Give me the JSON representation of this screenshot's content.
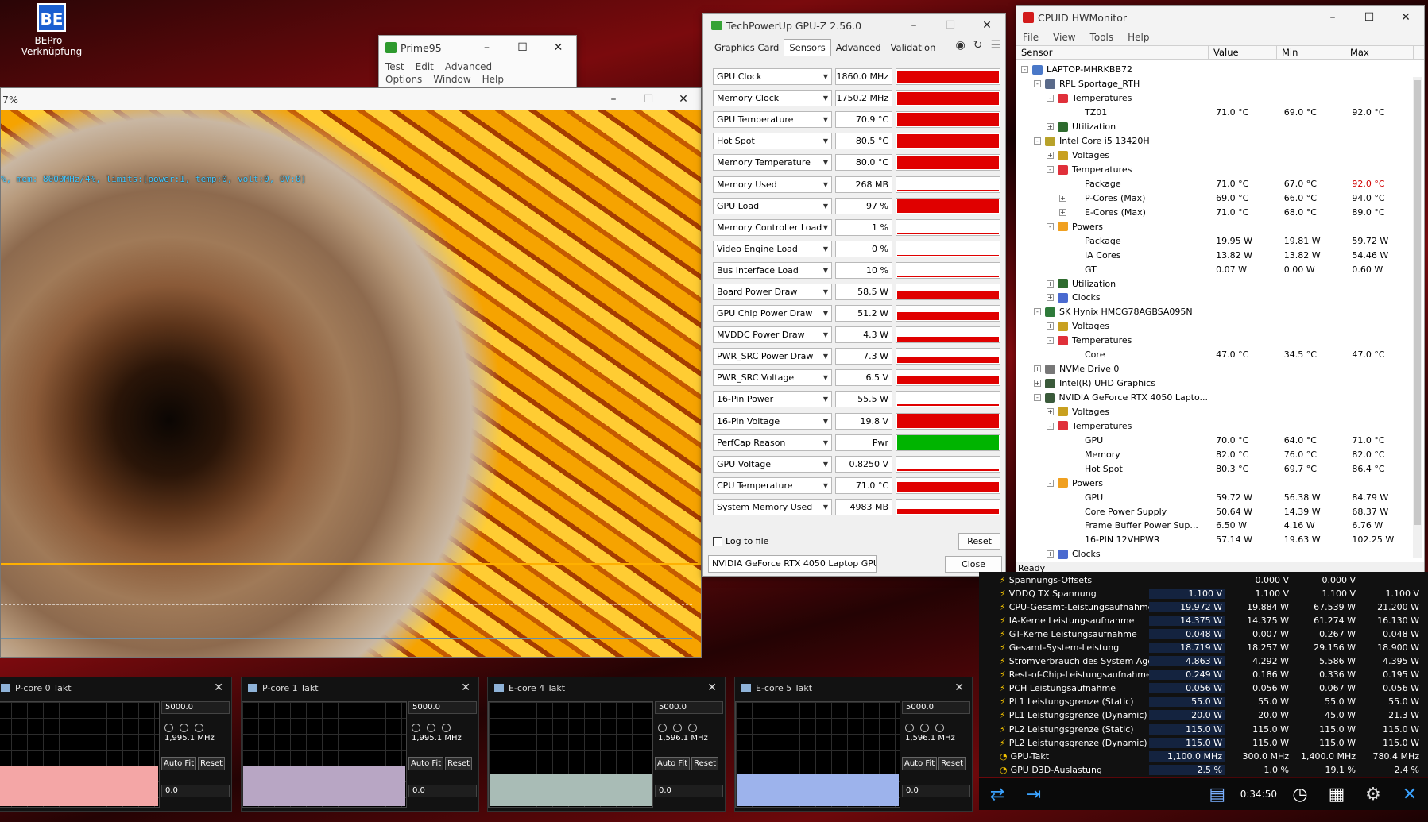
{
  "desktop": {
    "icon_label": "BEPro - Verknüpfung",
    "icon_text": "BE"
  },
  "prime95": {
    "title": "Prime95",
    "menu": [
      "Test",
      "Edit",
      "Advanced",
      "Options",
      "Window",
      "Help"
    ]
  },
  "bench": {
    "title_pct": "7%",
    "osd": "%, mem: 8000MHz/4%, limits:[power:1, temp:0, volt:0, OV:0]"
  },
  "gpuz": {
    "title": "TechPowerUp GPU-Z 2.56.0",
    "tabs": [
      "Graphics Card",
      "Sensors",
      "Advanced",
      "Validation"
    ],
    "active_tab": "Sensors",
    "sensors": [
      {
        "label": "GPU Clock",
        "value": "1860.0 MHz",
        "level": 0.85
      },
      {
        "label": "Memory Clock",
        "value": "1750.2 MHz",
        "level": 0.85
      },
      {
        "label": "GPU Temperature",
        "value": "70.9 °C",
        "level": 0.9
      },
      {
        "label": "Hot Spot",
        "value": "80.5 °C",
        "level": 0.92
      },
      {
        "label": "Memory Temperature",
        "value": "80.0 °C",
        "level": 0.92
      },
      {
        "label": "Memory Used",
        "value": "268 MB",
        "level": 0.1
      },
      {
        "label": "GPU Load",
        "value": "97 %",
        "level": 0.97
      },
      {
        "label": "Memory Controller Load",
        "value": "1 %",
        "level": 0.0
      },
      {
        "label": "Video Engine Load",
        "value": "0 %",
        "level": 0.0
      },
      {
        "label": "Bus Interface Load",
        "value": "10 %",
        "level": 0.1
      },
      {
        "label": "Board Power Draw",
        "value": "58.5 W",
        "level": 0.55
      },
      {
        "label": "GPU Chip Power Draw",
        "value": "51.2 W",
        "level": 0.5
      },
      {
        "label": "MVDDC Power Draw",
        "value": "4.3 W",
        "level": 0.3
      },
      {
        "label": "PWR_SRC Power Draw",
        "value": "7.3 W",
        "level": 0.4
      },
      {
        "label": "PWR_SRC Voltage",
        "value": "6.5 V",
        "level": 0.55
      },
      {
        "label": "16-Pin Power",
        "value": "55.5 W",
        "level": 0.1
      },
      {
        "label": "16-Pin Voltage",
        "value": "19.8 V",
        "level": 0.95
      },
      {
        "label": "PerfCap Reason",
        "value": "Pwr",
        "level": 1.0,
        "green": true
      },
      {
        "label": "GPU Voltage",
        "value": "0.8250 V",
        "level": 0.15
      },
      {
        "label": "CPU Temperature",
        "value": "71.0 °C",
        "level": 0.7
      },
      {
        "label": "System Memory Used",
        "value": "4983 MB",
        "level": 0.3
      }
    ],
    "log_to_file": "Log to file",
    "reset": "Reset",
    "gpu_select": "NVIDIA GeForce RTX 4050 Laptop GPU",
    "close": "Close"
  },
  "hwmonitor": {
    "title": "CPUID HWMonitor",
    "menu": [
      "File",
      "View",
      "Tools",
      "Help"
    ],
    "columns": [
      "Sensor",
      "Value",
      "Min",
      "Max"
    ],
    "rows": [
      {
        "d": 0,
        "e": "-",
        "i": "pc",
        "n": "LAPTOP-MHRKBB72",
        "v": "",
        "mn": "",
        "mx": ""
      },
      {
        "d": 1,
        "e": "-",
        "i": "board",
        "n": "RPL Sportage_RTH",
        "v": "",
        "mn": "",
        "mx": ""
      },
      {
        "d": 2,
        "e": "-",
        "i": "temp",
        "n": "Temperatures",
        "v": "",
        "mn": "",
        "mx": ""
      },
      {
        "d": 3,
        "e": "",
        "i": "",
        "n": "TZ01",
        "v": "71.0 °C",
        "mn": "69.0 °C",
        "mx": "92.0 °C"
      },
      {
        "d": 2,
        "e": "+",
        "i": "util",
        "n": "Utilization",
        "v": "",
        "mn": "",
        "mx": ""
      },
      {
        "d": 1,
        "e": "-",
        "i": "cpu",
        "n": "Intel Core i5 13420H",
        "v": "",
        "mn": "",
        "mx": ""
      },
      {
        "d": 2,
        "e": "+",
        "i": "volt",
        "n": "Voltages",
        "v": "",
        "mn": "",
        "mx": ""
      },
      {
        "d": 2,
        "e": "-",
        "i": "temp",
        "n": "Temperatures",
        "v": "",
        "mn": "",
        "mx": ""
      },
      {
        "d": 3,
        "e": "",
        "i": "",
        "n": "Package",
        "v": "71.0 °C",
        "mn": "67.0 °C",
        "mx": "92.0 °C",
        "red": true
      },
      {
        "d": 3,
        "e": "+",
        "i": "",
        "n": "P-Cores (Max)",
        "v": "69.0 °C",
        "mn": "66.0 °C",
        "mx": "94.0 °C"
      },
      {
        "d": 3,
        "e": "+",
        "i": "",
        "n": "E-Cores (Max)",
        "v": "71.0 °C",
        "mn": "68.0 °C",
        "mx": "89.0 °C"
      },
      {
        "d": 2,
        "e": "-",
        "i": "power",
        "n": "Powers",
        "v": "",
        "mn": "",
        "mx": ""
      },
      {
        "d": 3,
        "e": "",
        "i": "",
        "n": "Package",
        "v": "19.95 W",
        "mn": "19.81 W",
        "mx": "59.72 W"
      },
      {
        "d": 3,
        "e": "",
        "i": "",
        "n": "IA Cores",
        "v": "13.82 W",
        "mn": "13.82 W",
        "mx": "54.46 W"
      },
      {
        "d": 3,
        "e": "",
        "i": "",
        "n": "GT",
        "v": "0.07 W",
        "mn": "0.00 W",
        "mx": "0.60 W"
      },
      {
        "d": 2,
        "e": "+",
        "i": "util",
        "n": "Utilization",
        "v": "",
        "mn": "",
        "mx": ""
      },
      {
        "d": 2,
        "e": "+",
        "i": "clock",
        "n": "Clocks",
        "v": "",
        "mn": "",
        "mx": ""
      },
      {
        "d": 1,
        "e": "-",
        "i": "ram",
        "n": "SK Hynix HMCG78AGBSA095N",
        "v": "",
        "mn": "",
        "mx": ""
      },
      {
        "d": 2,
        "e": "+",
        "i": "volt",
        "n": "Voltages",
        "v": "",
        "mn": "",
        "mx": ""
      },
      {
        "d": 2,
        "e": "-",
        "i": "temp",
        "n": "Temperatures",
        "v": "",
        "mn": "",
        "mx": ""
      },
      {
        "d": 3,
        "e": "",
        "i": "",
        "n": "Core",
        "v": "47.0 °C",
        "mn": "34.5 °C",
        "mx": "47.0 °C"
      },
      {
        "d": 1,
        "e": "+",
        "i": "drive",
        "n": "NVMe Drive 0",
        "v": "",
        "mn": "",
        "mx": ""
      },
      {
        "d": 1,
        "e": "+",
        "i": "gpu",
        "n": "Intel(R) UHD Graphics",
        "v": "",
        "mn": "",
        "mx": ""
      },
      {
        "d": 1,
        "e": "-",
        "i": "gpu",
        "n": "NVIDIA GeForce RTX 4050 Lapto...",
        "v": "",
        "mn": "",
        "mx": ""
      },
      {
        "d": 2,
        "e": "+",
        "i": "volt",
        "n": "Voltages",
        "v": "",
        "mn": "",
        "mx": ""
      },
      {
        "d": 2,
        "e": "-",
        "i": "temp",
        "n": "Temperatures",
        "v": "",
        "mn": "",
        "mx": ""
      },
      {
        "d": 3,
        "e": "",
        "i": "",
        "n": "GPU",
        "v": "70.0 °C",
        "mn": "64.0 °C",
        "mx": "71.0 °C"
      },
      {
        "d": 3,
        "e": "",
        "i": "",
        "n": "Memory",
        "v": "82.0 °C",
        "mn": "76.0 °C",
        "mx": "82.0 °C"
      },
      {
        "d": 3,
        "e": "",
        "i": "",
        "n": "Hot Spot",
        "v": "80.3 °C",
        "mn": "69.7 °C",
        "mx": "86.4 °C"
      },
      {
        "d": 2,
        "e": "-",
        "i": "power",
        "n": "Powers",
        "v": "",
        "mn": "",
        "mx": ""
      },
      {
        "d": 3,
        "e": "",
        "i": "",
        "n": "GPU",
        "v": "59.72 W",
        "mn": "56.38 W",
        "mx": "84.79 W"
      },
      {
        "d": 3,
        "e": "",
        "i": "",
        "n": "Core Power Supply",
        "v": "50.64 W",
        "mn": "14.39 W",
        "mx": "68.37 W"
      },
      {
        "d": 3,
        "e": "",
        "i": "",
        "n": "Frame Buffer Power Sup...",
        "v": "6.50 W",
        "mn": "4.16 W",
        "mx": "6.76 W"
      },
      {
        "d": 3,
        "e": "",
        "i": "",
        "n": "16-PIN 12VHPWR",
        "v": "57.14 W",
        "mn": "19.63 W",
        "mx": "102.25 W"
      },
      {
        "d": 2,
        "e": "+",
        "i": "clock",
        "n": "Clocks",
        "v": "",
        "mn": "",
        "mx": ""
      }
    ],
    "status": "Ready"
  },
  "hwinfo": {
    "rows": [
      {
        "n": "Spannungs-Offsets",
        "c": "",
        "mn": "0.000 V",
        "mx": "0.000 V",
        "av": ""
      },
      {
        "n": "VDDQ TX Spannung",
        "c": "1.100 V",
        "mn": "1.100 V",
        "mx": "1.100 V",
        "av": "1.100 V"
      },
      {
        "n": "CPU-Gesamt-Leistungsaufnahme",
        "c": "19.972 W",
        "mn": "19.884 W",
        "mx": "67.539 W",
        "av": "21.200 W"
      },
      {
        "n": "IA-Kerne Leistungsaufnahme",
        "c": "14.375 W",
        "mn": "14.375 W",
        "mx": "61.274 W",
        "av": "16.130 W"
      },
      {
        "n": "GT-Kerne Leistungsaufnahme",
        "c": "0.048 W",
        "mn": "0.007 W",
        "mx": "0.267 W",
        "av": "0.048 W"
      },
      {
        "n": "Gesamt-System-Leistung",
        "c": "18.719 W",
        "mn": "18.257 W",
        "mx": "29.156 W",
        "av": "18.900 W"
      },
      {
        "n": "Stromverbrauch des System Agent",
        "c": "4.863 W",
        "mn": "4.292 W",
        "mx": "5.586 W",
        "av": "4.395 W"
      },
      {
        "n": "Rest-of-Chip-Leistungsaufnahme",
        "c": "0.249 W",
        "mn": "0.186 W",
        "mx": "0.336 W",
        "av": "0.195 W"
      },
      {
        "n": "PCH Leistungsaufnahme",
        "c": "0.056 W",
        "mn": "0.056 W",
        "mx": "0.067 W",
        "av": "0.056 W"
      },
      {
        "n": "PL1 Leistungsgrenze (Static)",
        "c": "55.0 W",
        "mn": "55.0 W",
        "mx": "55.0 W",
        "av": "55.0 W"
      },
      {
        "n": "PL1 Leistungsgrenze (Dynamic)",
        "c": "20.0 W",
        "mn": "20.0 W",
        "mx": "45.0 W",
        "av": "21.3 W"
      },
      {
        "n": "PL2 Leistungsgrenze (Static)",
        "c": "115.0 W",
        "mn": "115.0 W",
        "mx": "115.0 W",
        "av": "115.0 W"
      },
      {
        "n": "PL2 Leistungsgrenze (Dynamic)",
        "c": "115.0 W",
        "mn": "115.0 W",
        "mx": "115.0 W",
        "av": "115.0 W"
      },
      {
        "n": "GPU-Takt",
        "c": "1,100.0 MHz",
        "mn": "300.0 MHz",
        "mx": "1,400.0 MHz",
        "av": "780.4 MHz",
        "clock": true
      },
      {
        "n": "GPU D3D-Auslastung",
        "c": "2.5 %",
        "mn": "1.0 %",
        "mx": "19.1 %",
        "av": "2.4 %",
        "clock": true
      }
    ],
    "elapsed": "0:34:50"
  },
  "clock_graphs": [
    {
      "title": "P-core 0 Takt",
      "max": "5000.0",
      "cur": "1,995.1 MHz",
      "min": "0.0",
      "color": "#f4a6a6",
      "level": 0.39
    },
    {
      "title": "P-core 1 Takt",
      "max": "5000.0",
      "cur": "1,995.1 MHz",
      "min": "0.0",
      "color": "#b8a6c4",
      "level": 0.39
    },
    {
      "title": "E-core 4 Takt",
      "max": "5000.0",
      "cur": "1,596.1 MHz",
      "min": "0.0",
      "color": "#a9bcb6",
      "level": 0.31
    },
    {
      "title": "E-core 5 Takt",
      "max": "5000.0",
      "cur": "1,596.1 MHz",
      "min": "0.0",
      "color": "#9db3ec",
      "level": 0.31
    }
  ],
  "clock_graph_buttons": {
    "autofit": "Auto Fit",
    "reset": "Reset"
  },
  "icons": {
    "gpuz": "gpuz-icon",
    "hwmonitor": "hwmonitor-icon",
    "prime95": "prime95-icon"
  }
}
